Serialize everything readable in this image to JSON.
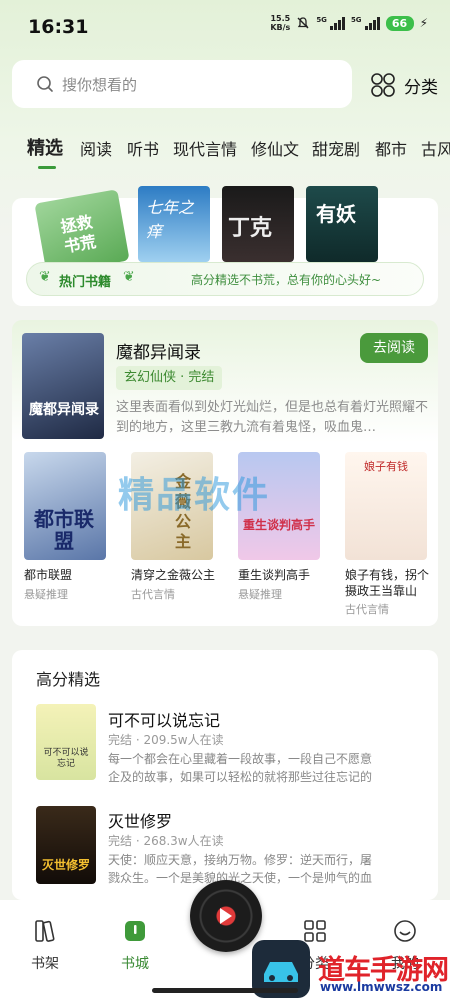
{
  "status_bar": {
    "time": "16:31",
    "speed_top": "15.5",
    "speed_unit": "KB/s",
    "net1": "5G",
    "net2": "5G",
    "battery": "66"
  },
  "search": {
    "placeholder": "搜你想看的",
    "category_label": "分类"
  },
  "tabs": [
    "精选",
    "阅读",
    "听书",
    "现代言情",
    "修仙文",
    "甜宠剧",
    "都市",
    "古风"
  ],
  "hot_banner": {
    "covers": [
      "拯救书荒",
      "七年之痒",
      "丁克",
      "有妖"
    ],
    "title": "热门书籍",
    "subtitle": "高分精选不书荒，总有你的心头好~"
  },
  "featured": {
    "title": "魔都异闻录",
    "read_button": "去阅读",
    "tag": "玄幻仙侠 · 完结",
    "description": "这里表面看似到处灯光灿烂，但是也总有着灯光照耀不到的地方，这里三教九流有着鬼怪，吸血鬼…",
    "cover_text": "魔都异闻录"
  },
  "grid_books": [
    {
      "title": "都市联盟",
      "genre": "悬疑推理",
      "cover_text": "都市联盟"
    },
    {
      "title": "清穿之金薇公主",
      "genre": "古代言情",
      "cover_text": "金薇公主"
    },
    {
      "title": "重生谈判高手",
      "genre": "悬疑推理",
      "cover_text": "重生谈判高手"
    },
    {
      "title": "娘子有钱，拐个摄政王当靠山",
      "genre": "古代言情",
      "cover_text": "娘子有钱"
    }
  ],
  "watermark_center": "精品软件",
  "high_score": {
    "section_title": "高分精选",
    "items": [
      {
        "title": "可不可以说忘记",
        "meta": "完结 · 209.5w人在读",
        "desc": "每一个都会在心里藏着一段故事，一段自己不愿意企及的故事，如果可以轻松的就将那些过往忘记的话，你…",
        "cover_text": "可不可以说忘记"
      },
      {
        "title": "灭世修罗",
        "meta": "完结 · 268.3w人在读",
        "desc": "天使：顺应天意，接纳万物。修罗：逆天而行，屠戮众生。一个是美貌的光之天使，一个是帅气的血之修罗…",
        "cover_text": "灭世修罗"
      }
    ]
  },
  "bottom_nav": [
    {
      "label": "书架",
      "icon": "bookshelf-icon"
    },
    {
      "label": "书城",
      "icon": "bookstore-icon"
    },
    {
      "label": "分类",
      "icon": "category-grid-icon"
    },
    {
      "label": "我的",
      "icon": "profile-icon"
    }
  ],
  "watermark": {
    "text": "道车手游网",
    "url": "www.lmwwsz.com"
  },
  "colors": {
    "accent": "#4a9a3c",
    "tag_bg": "#e3f2d9",
    "watermark_red": "#e0232a"
  }
}
